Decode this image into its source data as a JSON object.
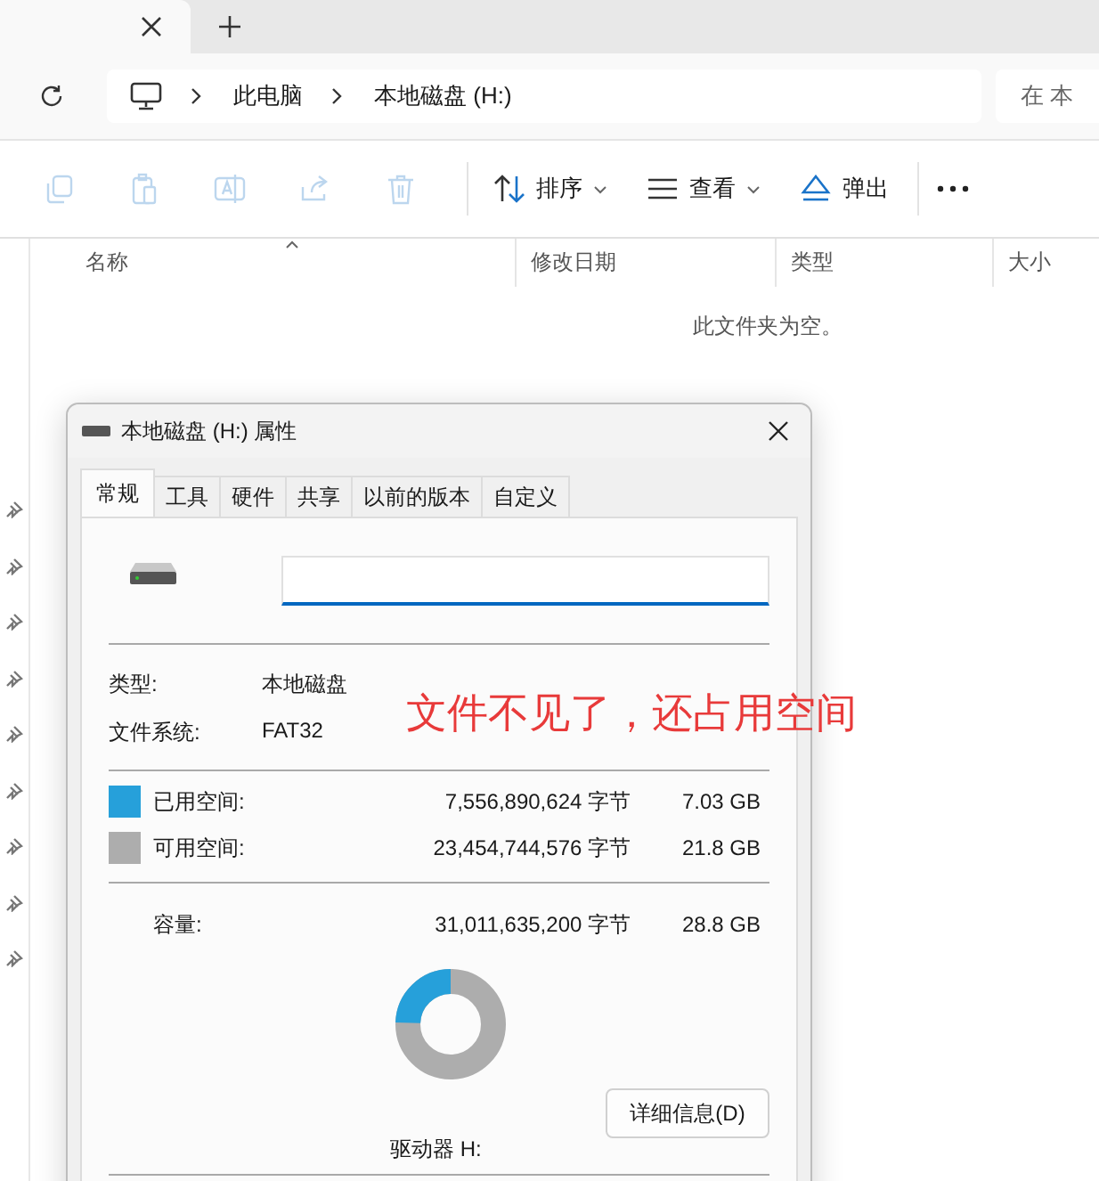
{
  "tab_bar": {
    "tabs": [
      {
        "selected": true
      }
    ]
  },
  "address_bar": {
    "crumbs": [
      "此电脑",
      "本地磁盘 (H:)"
    ],
    "search_placeholder": "在 本"
  },
  "toolbar": {
    "items": [
      {
        "kind": "copy",
        "disabled": true
      },
      {
        "kind": "paste",
        "disabled": true
      },
      {
        "kind": "rename",
        "disabled": true
      },
      {
        "kind": "share",
        "disabled": true
      },
      {
        "kind": "delete",
        "disabled": true
      },
      {
        "kind": "sort",
        "label": "排序",
        "dropdown": true
      },
      {
        "kind": "view",
        "label": "查看",
        "dropdown": true
      },
      {
        "kind": "eject",
        "label": "弹出"
      },
      {
        "kind": "more"
      }
    ]
  },
  "file_list": {
    "columns": [
      "名称",
      "修改日期",
      "类型",
      "大小"
    ],
    "empty_message": "此文件夹为空。"
  },
  "dialog": {
    "title": "本地磁盘 (H:) 属性",
    "tabs": [
      {
        "label": "常规",
        "selected": true
      },
      {
        "label": "工具",
        "selected": false
      },
      {
        "label": "硬件",
        "selected": false
      },
      {
        "label": "共享",
        "selected": false
      },
      {
        "label": "以前的版本",
        "selected": false
      },
      {
        "label": "自定义",
        "selected": false
      }
    ],
    "properties": [
      {
        "label": "类型:",
        "value": "本地磁盘"
      },
      {
        "label": "文件系统:",
        "value": "FAT32"
      }
    ],
    "space": [
      {
        "label": "已用空间:",
        "bytes": "7,556,890,624 字节",
        "size": "7.03 GB",
        "color": "#26a0da"
      },
      {
        "label": "可用空间:",
        "bytes": "23,454,744,576 字节",
        "size": "21.8 GB",
        "color": "#adadad"
      }
    ],
    "capacity": {
      "label": "容量:",
      "bytes": "31,011,635,200 字节",
      "size": "28.8 GB"
    },
    "usage_ring": {
      "level": 0.244
    },
    "drive_label": "驱动器 H:",
    "details_button": "详细信息(D)"
  },
  "annotation": "文件不见了，还占用空间"
}
